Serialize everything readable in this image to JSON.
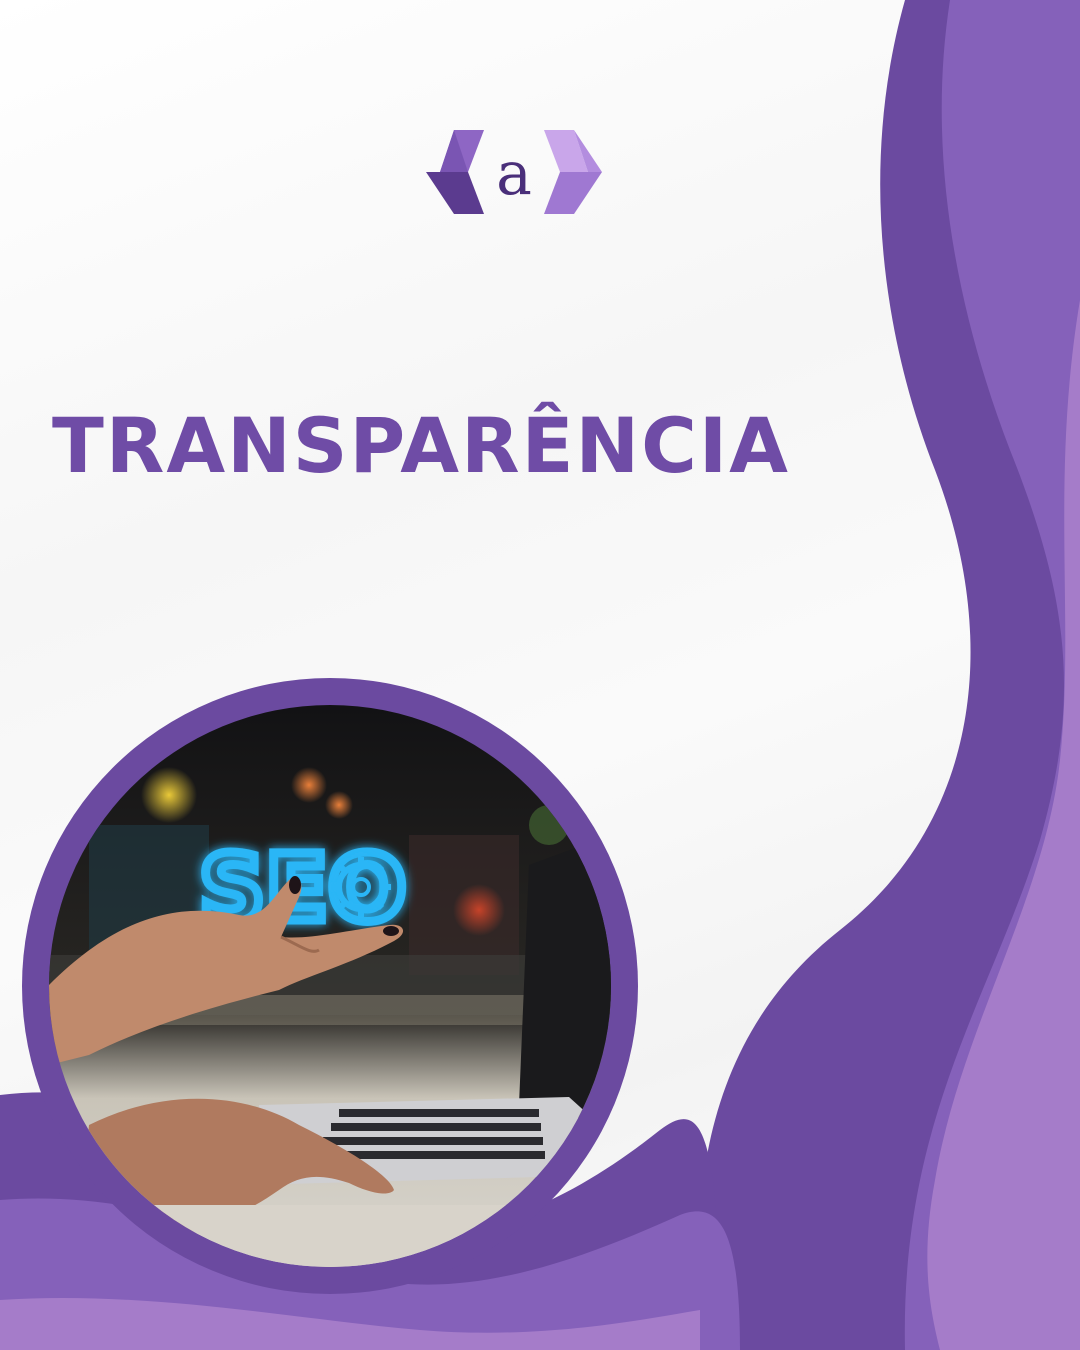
{
  "headline": "TRANSPARÊNCIA",
  "logo": {
    "letter": "a"
  },
  "photo": {
    "overlay_text": "SEO",
    "icon": "gear-icon"
  },
  "colors": {
    "headline": "#6f4ca6",
    "wave_dark": "#6b4aa0",
    "wave_mid": "#8561ba",
    "wave_light": "#a57cc9",
    "seo_glow": "#29b6f6"
  }
}
